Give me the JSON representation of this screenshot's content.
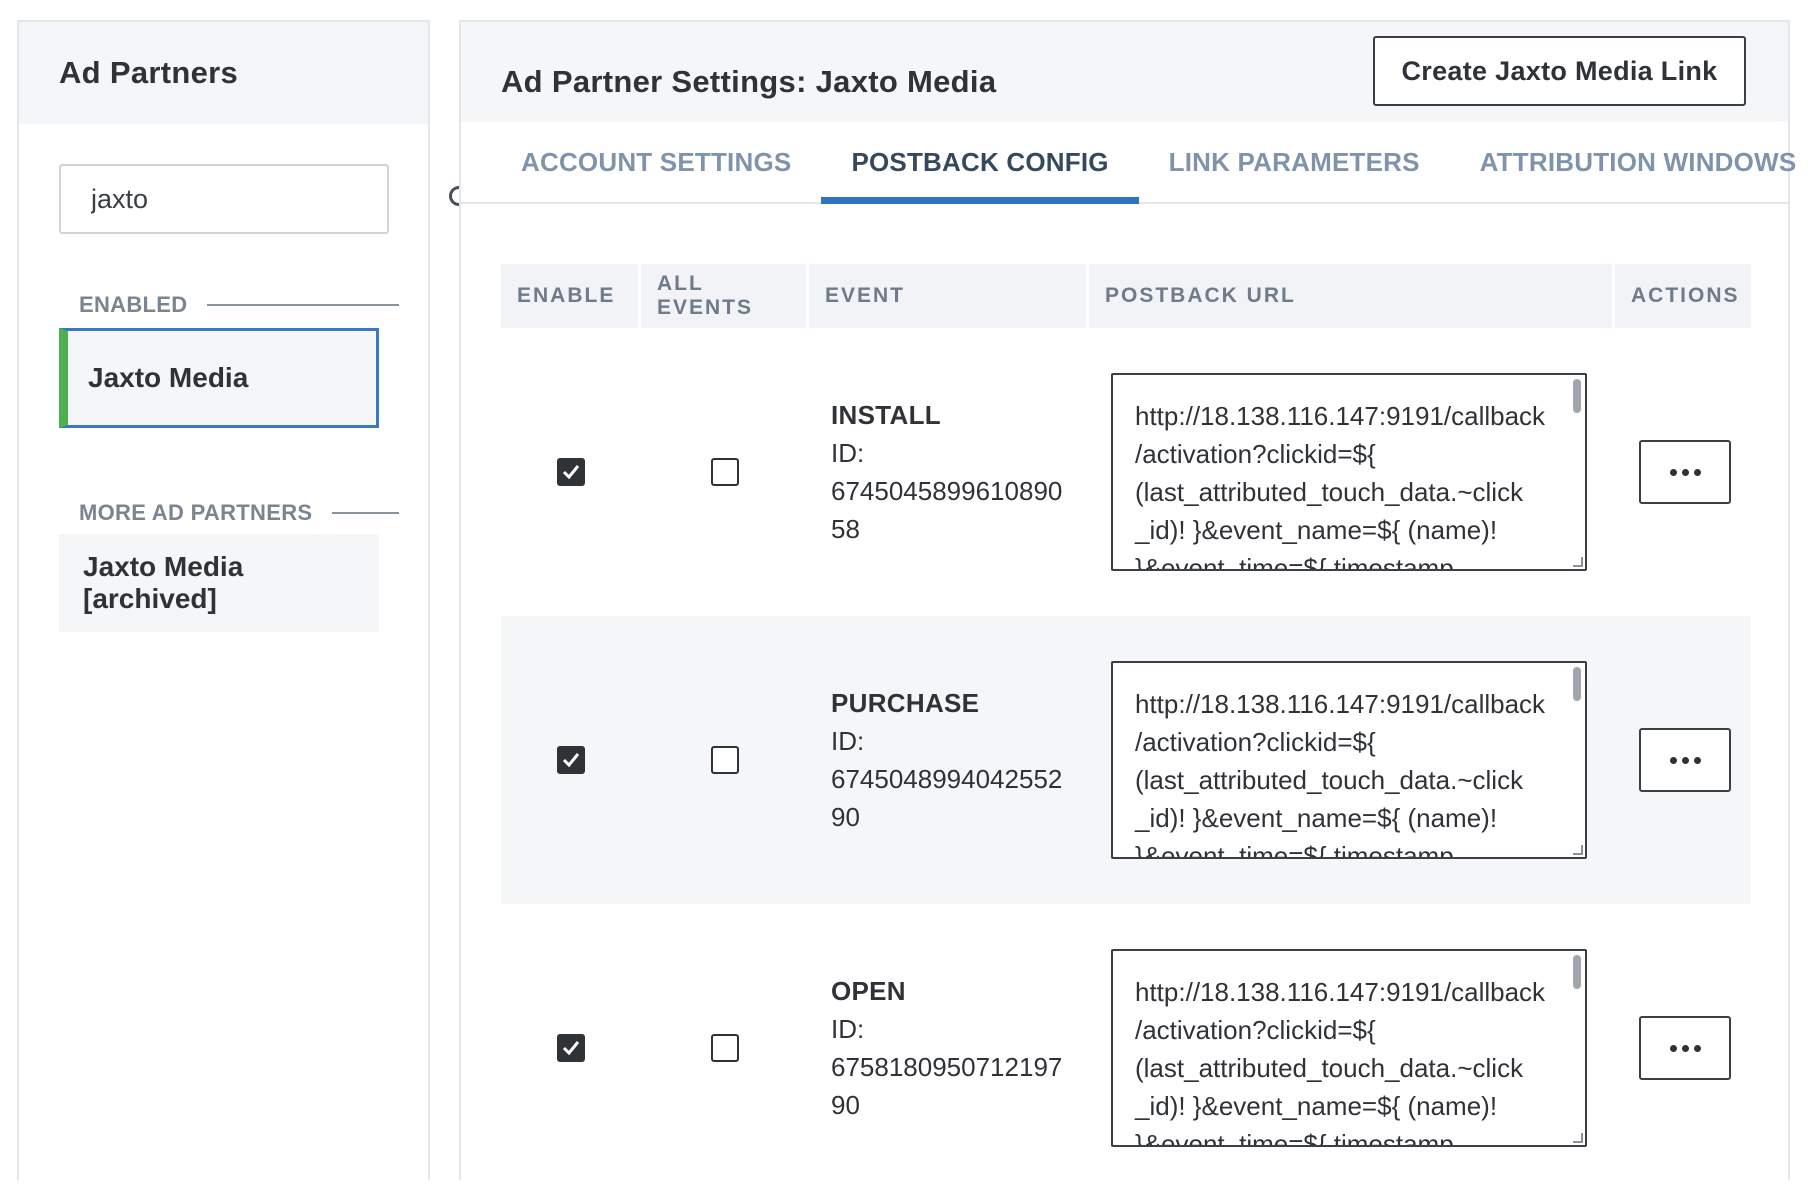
{
  "sidebar": {
    "title": "Ad Partners",
    "search": {
      "value": "jaxto",
      "placeholder": ""
    },
    "enabled_label": "ENABLED",
    "enabled_items": [
      {
        "label": "Jaxto Media"
      }
    ],
    "more_label": "MORE AD PARTNERS",
    "more_items": [
      {
        "label": "Jaxto Media [archived]"
      }
    ]
  },
  "main": {
    "title": "Ad Partner Settings: Jaxto Media",
    "create_link_label": "Create Jaxto Media Link",
    "tabs": [
      {
        "label": "ACCOUNT SETTINGS",
        "active": false
      },
      {
        "label": "POSTBACK CONFIG",
        "active": true
      },
      {
        "label": "LINK PARAMETERS",
        "active": false
      },
      {
        "label": "ATTRIBUTION WINDOWS",
        "active": false
      }
    ],
    "table": {
      "headers": {
        "enable": "ENABLE",
        "all_events": "ALL EVENTS",
        "event": "EVENT",
        "postback_url": "POSTBACK URL",
        "actions": "ACTIONS"
      },
      "rows": [
        {
          "enabled": true,
          "all_events": false,
          "event_name": "INSTALL",
          "id_label": "ID:",
          "id_value": "674504589961089058",
          "id_line1": "6745045899610890",
          "id_line2": "58",
          "url_lines": [
            "http://18.138.116.147:9191/callback",
            "/activation?clickid=${",
            "(last_attributed_touch_data.~click",
            "_id)! }&event_name=${ (name)!",
            "}&event_time=${ timestamp"
          ]
        },
        {
          "enabled": true,
          "all_events": false,
          "event_name": "PURCHASE",
          "id_label": "ID:",
          "id_value": "674504899404255290",
          "id_line1": "6745048994042552",
          "id_line2": "90",
          "url_lines": [
            "http://18.138.116.147:9191/callback",
            "/activation?clickid=${",
            "(last_attributed_touch_data.~click",
            "_id)! }&event_name=${ (name)!",
            "}&event_time=${ timestamp"
          ]
        },
        {
          "enabled": true,
          "all_events": false,
          "event_name": "OPEN",
          "id_label": "ID:",
          "id_value": "675818095071219790",
          "id_line1": "6758180950712197",
          "id_line2": "90",
          "url_lines": [
            "http://18.138.116.147:9191/callback",
            "/activation?clickid=${",
            "(last_attributed_touch_data.~click",
            "_id)! }&event_name=${ (name)!",
            "}&event_time=${ timestamp"
          ]
        }
      ]
    }
  },
  "colors": {
    "accent": "#2f73c4",
    "enabled_marker": "#4caf50",
    "tab_inactive": "#7f94ab"
  }
}
